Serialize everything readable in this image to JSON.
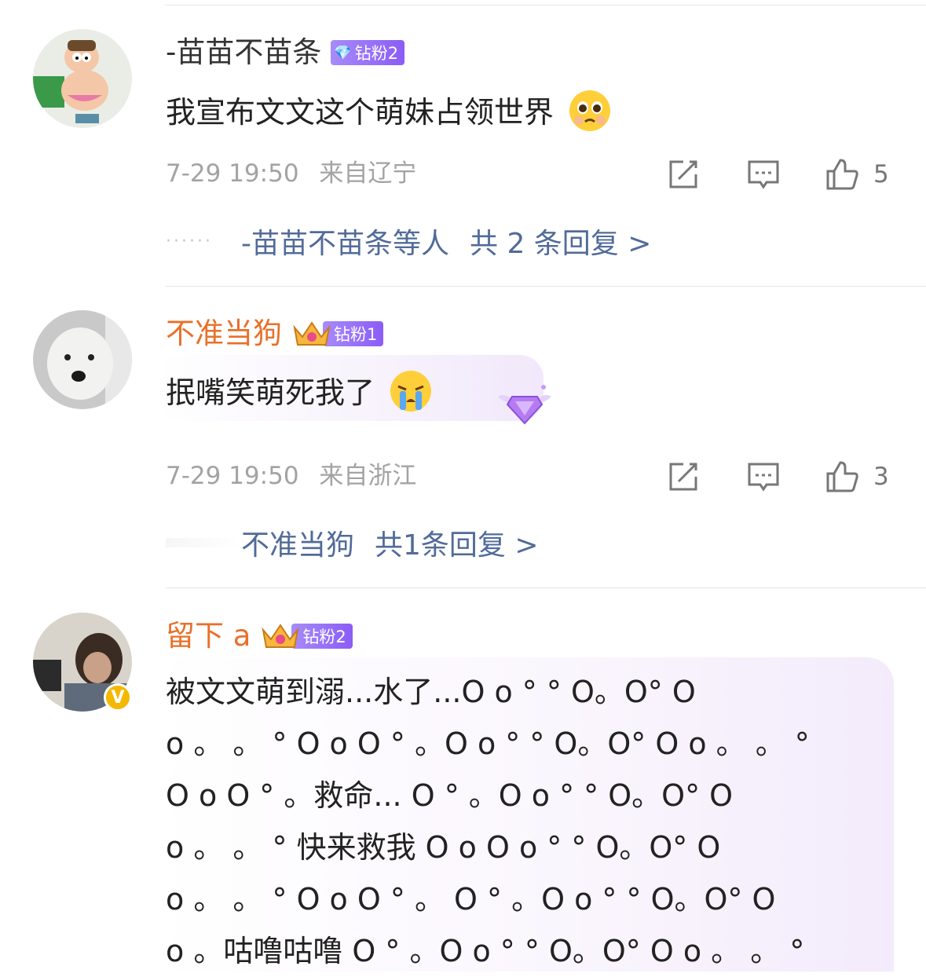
{
  "comments": [
    {
      "username": "-苗苗不苗条",
      "badge": "钻粉2",
      "text": "我宣布文文这个萌妹占领世界",
      "date": "7-29 19:50",
      "location": "来自辽宁",
      "likes": "5",
      "reply_from": "-苗苗不苗条等人",
      "reply_total": "共 2 条回复 >"
    },
    {
      "username": "不准当狗",
      "badge": "钻粉1",
      "text": "抿嘴笑萌死我了",
      "date": "7-29 19:50",
      "location": "来自浙江",
      "likes": "3",
      "reply_from": "不准当狗",
      "reply_total": "共1条回复 >"
    },
    {
      "username": "留下 a",
      "badge": "钻粉2",
      "text": "被文文萌到溺...水了...O o ° ° O。O° O\no 。 。 ° O o O ° 。O o ° ° O。O° O o 。 。 °\nO o O ° 。救命... O ° 。O o ° ° O。O° O\no 。 。 ° 快来救我 O o O o ° ° O。O° O\no 。 。 ° O o O ° 。 O ° 。O o ° ° O。O° O\no 。咕噜咕噜 O ° 。O o ° ° O。O° O o 。 。 °",
      "verified_mark": "V"
    }
  ],
  "icons": {
    "repost": "share-edit-icon",
    "comment": "comment-bubble-icon",
    "like": "thumbs-up-icon",
    "badge_gem": "diamond-icon",
    "crown": "crown-icon"
  },
  "colors": {
    "vip_name": "#e8702a",
    "reply_link": "#516b99",
    "meta_gray": "#a3a3a3",
    "badge_purple": "#8b5cf6",
    "verified": "#f5b800"
  }
}
